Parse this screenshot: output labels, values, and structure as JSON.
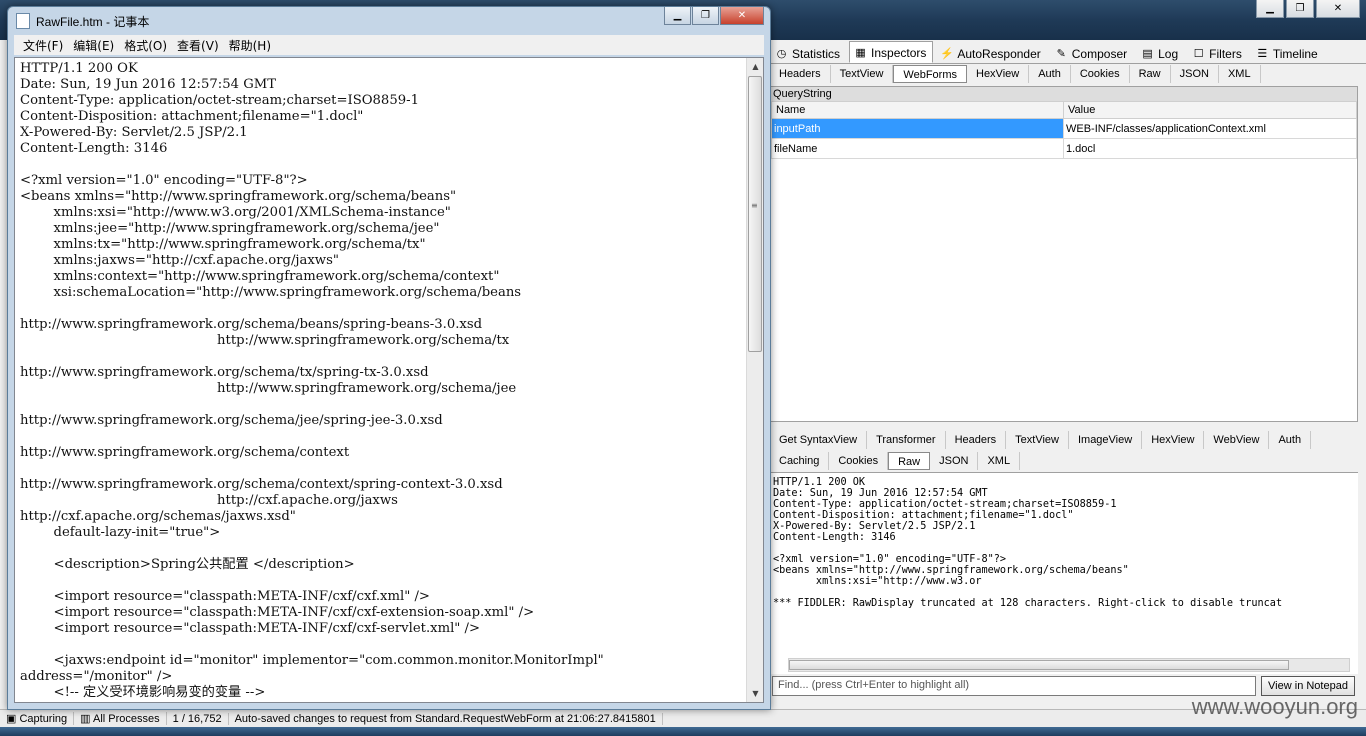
{
  "notepad": {
    "title": "RawFile.htm - 记事本",
    "menu": [
      "文件(F)",
      "编辑(E)",
      "格式(O)",
      "查看(V)",
      "帮助(H)"
    ],
    "content": "HTTP/1.1 200 OK\nDate: Sun, 19 Jun 2016 12:57:54 GMT\nContent-Type: application/octet-stream;charset=ISO8859-1\nContent-Disposition: attachment;filename=\"1.docl\"\nX-Powered-By: Servlet/2.5 JSP/2.1\nContent-Length: 3146\n\n<?xml version=\"1.0\" encoding=\"UTF-8\"?>\n<beans xmlns=\"http://www.springframework.org/schema/beans\"\n        xmlns:xsi=\"http://www.w3.org/2001/XMLSchema-instance\"\n        xmlns:jee=\"http://www.springframework.org/schema/jee\"\n        xmlns:tx=\"http://www.springframework.org/schema/tx\"\n        xmlns:jaxws=\"http://cxf.apache.org/jaxws\"\n        xmlns:context=\"http://www.springframework.org/schema/context\"\n        xsi:schemaLocation=\"http://www.springframework.org/schema/beans\n\nhttp://www.springframework.org/schema/beans/spring-beans-3.0.xsd\n                                               http://www.springframework.org/schema/tx\n\nhttp://www.springframework.org/schema/tx/spring-tx-3.0.xsd\n                                               http://www.springframework.org/schema/jee\n\nhttp://www.springframework.org/schema/jee/spring-jee-3.0.xsd\n\nhttp://www.springframework.org/schema/context\n\nhttp://www.springframework.org/schema/context/spring-context-3.0.xsd\n                                               http://cxf.apache.org/jaxws\nhttp://cxf.apache.org/schemas/jaxws.xsd\"\n        default-lazy-init=\"true\">\n\n        <description>Spring公共配置 </description>\n\n        <import resource=\"classpath:META-INF/cxf/cxf.xml\" />\n        <import resource=\"classpath:META-INF/cxf/cxf-extension-soap.xml\" />\n        <import resource=\"classpath:META-INF/cxf/cxf-servlet.xml\" />\n\n        <jaxws:endpoint id=\"monitor\" implementor=\"com.common.monitor.MonitorImpl\"\naddress=\"/monitor\" />\n        <!-- 定义受环境影响易变的变量 -->"
  },
  "fiddler": {
    "inspector_tabs": [
      "Statistics",
      "Inspectors",
      "AutoResponder",
      "Composer",
      "Log",
      "Filters",
      "Timeline"
    ],
    "active_inspector_tab": "Inspectors",
    "request_tabs": [
      "Headers",
      "TextView",
      "WebForms",
      "HexView",
      "Auth",
      "Cookies",
      "Raw",
      "JSON",
      "XML"
    ],
    "active_request_tab": "WebForms",
    "querystring_label": "QueryString",
    "columns": [
      "Name",
      "Value"
    ],
    "rows": [
      {
        "name": "inputPath",
        "value": "WEB-INF/classes/applicationContext.xml"
      },
      {
        "name": "fileName",
        "value": "1.docl"
      }
    ],
    "response_tabs_row1": [
      "Get SyntaxView",
      "Transformer",
      "Headers",
      "TextView",
      "ImageView",
      "HexView",
      "WebView",
      "Auth"
    ],
    "response_tabs_row2": [
      "Caching",
      "Cookies",
      "Raw",
      "JSON",
      "XML"
    ],
    "active_response_tab": "Raw",
    "response_text": "HTTP/1.1 200 OK\nDate: Sun, 19 Jun 2016 12:57:54 GMT\nContent-Type: application/octet-stream;charset=ISO8859-1\nContent-Disposition: attachment;filename=\"1.docl\"\nX-Powered-By: Servlet/2.5 JSP/2.1\nContent-Length: 3146\n\n<?xml version=\"1.0\" encoding=\"UTF-8\"?>\n<beans xmlns=\"http://www.springframework.org/schema/beans\"\n       xmlns:xsi=\"http://www.w3.or\n\n*** FIDDLER: RawDisplay truncated at 128 characters. Right-click to disable truncat",
    "find_placeholder": "Find... (press Ctrl+Enter to highlight all)",
    "view_in_notepad": "View in Notepad"
  },
  "statusbar": {
    "capturing": "Capturing",
    "processes": "All Processes",
    "count": "1 / 16,752",
    "message": "Auto-saved changes to request from Standard.RequestWebForm at 21:06:27.8415801"
  },
  "watermark": "www.wooyun.org"
}
